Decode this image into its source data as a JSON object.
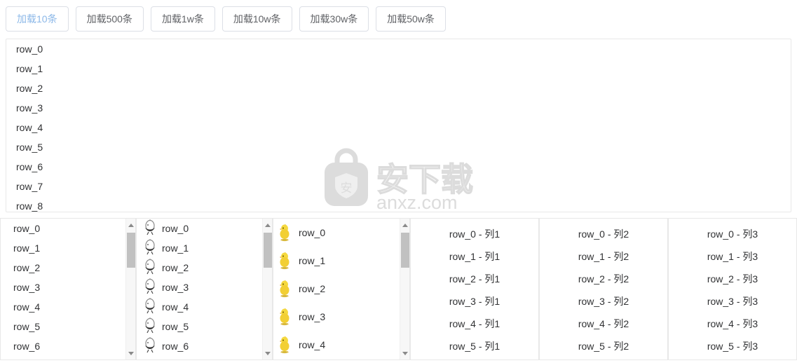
{
  "toolbar": {
    "buttons": [
      {
        "label": "加载10条",
        "active": true
      },
      {
        "label": "加载500条",
        "active": false
      },
      {
        "label": "加载1w条",
        "active": false
      },
      {
        "label": "加载10w条",
        "active": false
      },
      {
        "label": "加载30w条",
        "active": false
      },
      {
        "label": "加载50w条",
        "active": false
      }
    ]
  },
  "top_list": {
    "rows": [
      "row_0",
      "row_1",
      "row_2",
      "row_3",
      "row_4",
      "row_5",
      "row_6",
      "row_7",
      "row_8"
    ]
  },
  "watermark": {
    "logo_glyph": "安",
    "cn_text": "安下载",
    "url_text": "anxz.com",
    "color": "#dcdcdc"
  },
  "panels": {
    "plain_list": {
      "icon": "none",
      "scrollbar": {
        "up_icon": "triangle-up-icon",
        "down_icon": "triangle-down-icon"
      },
      "rows": [
        "row_0",
        "row_1",
        "row_2",
        "row_3",
        "row_4",
        "row_5",
        "row_6"
      ]
    },
    "bird_list": {
      "icon": "bird-outline-icon",
      "scrollbar": {
        "up_icon": "triangle-up-icon",
        "down_icon": "triangle-down-icon"
      },
      "rows": [
        "row_0",
        "row_1",
        "row_2",
        "row_3",
        "row_4",
        "row_5",
        "row_6"
      ]
    },
    "chick_list": {
      "icon": "chick-icon",
      "scrollbar": {
        "up_icon": "triangle-up-icon",
        "down_icon": "triangle-down-icon"
      },
      "rows": [
        "row_0",
        "row_1",
        "row_2",
        "row_3",
        "row_4"
      ]
    },
    "columns": [
      {
        "name": "列1",
        "rows": [
          "row_0 - 列1",
          "row_1 - 列1",
          "row_2 - 列1",
          "row_3 - 列1",
          "row_4 - 列1",
          "row_5 - 列1"
        ]
      },
      {
        "name": "列2",
        "rows": [
          "row_0 - 列2",
          "row_1 - 列2",
          "row_2 - 列2",
          "row_3 - 列2",
          "row_4 - 列2",
          "row_5 - 列2"
        ]
      },
      {
        "name": "列3",
        "rows": [
          "row_0 - 列3",
          "row_1 - 列3",
          "row_2 - 列3",
          "row_3 - 列3",
          "row_4 - 列3",
          "row_5 - 列3"
        ]
      }
    ]
  },
  "colors": {
    "accent": "#8cb8e8",
    "border": "#dcdfe6",
    "panel_border": "#e8e8e8",
    "text": "#303133",
    "scroll_thumb": "#c1c1c1",
    "chick_yellow": "#f2d544"
  }
}
